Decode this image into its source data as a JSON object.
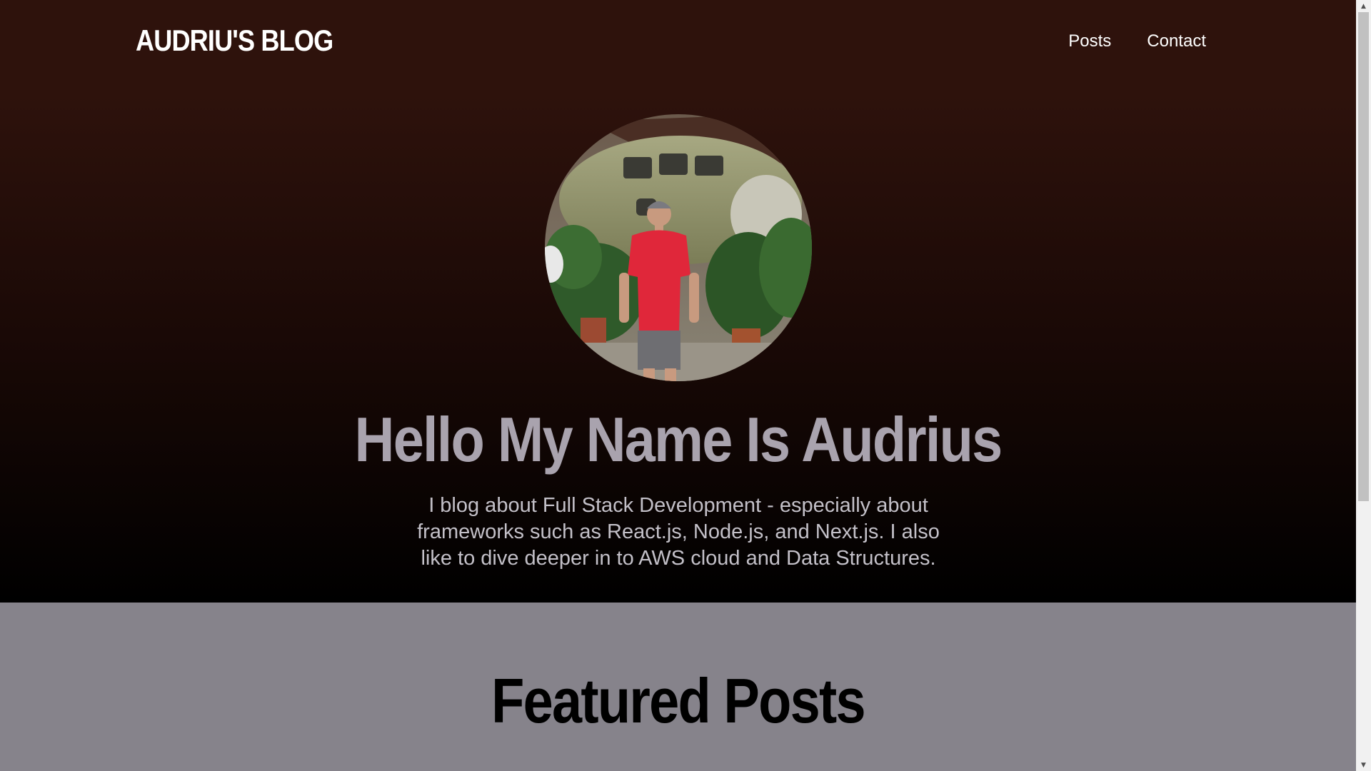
{
  "header": {
    "logo": "AUDRIU'S BLOG",
    "nav": [
      {
        "label": "Posts"
      },
      {
        "label": "Contact"
      }
    ]
  },
  "hero": {
    "avatar_alt": "Audrius standing in front of an old airplane surrounded by plants",
    "title": "Hello My Name Is Audrius",
    "description": "I blog about Full Stack Development - especially about frameworks such as React.js, Node.js, and Next.js. I also like to dive deeper in to AWS cloud and Data Structures."
  },
  "featured": {
    "title": "Featured Posts"
  },
  "colors": {
    "hero_top": "#2e120c",
    "hero_bottom": "#000000",
    "hero_title": "#a9a3ae",
    "featured_bg": "#86838b"
  }
}
